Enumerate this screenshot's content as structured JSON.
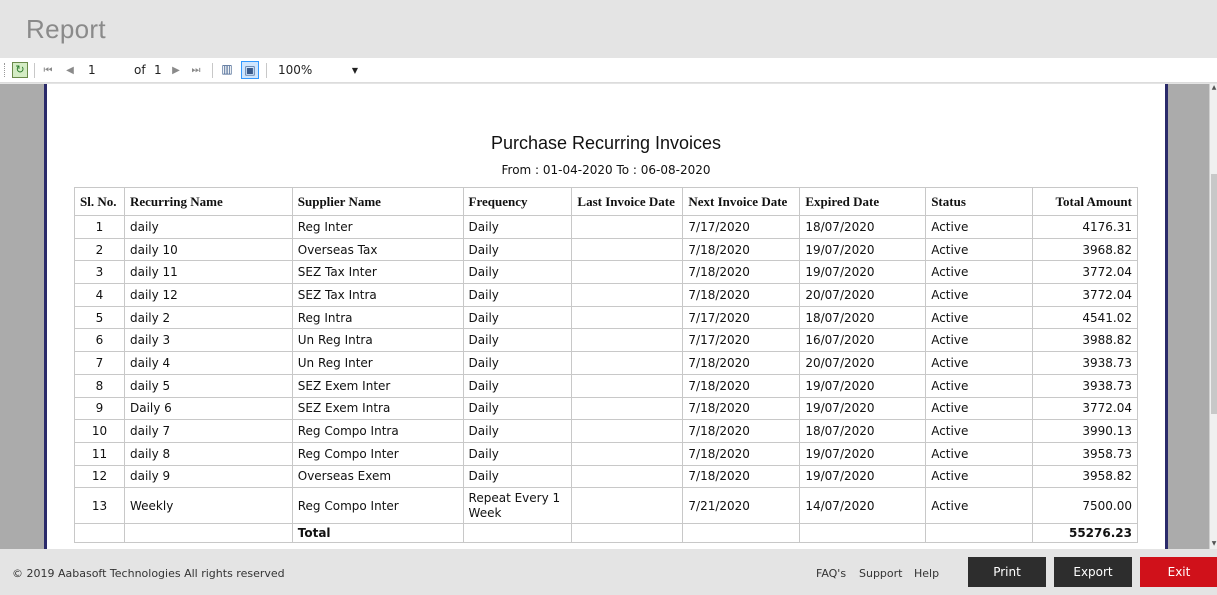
{
  "window": {
    "title": "Report"
  },
  "toolbar": {
    "page_current": "1",
    "of_label": "of",
    "page_total": "1",
    "zoom": "100%"
  },
  "report": {
    "title": "Purchase Recurring Invoices",
    "date_range": "From : 01-04-2020 To : 06-08-2020",
    "columns": [
      "Sl. No.",
      "Recurring Name",
      "Supplier Name",
      "Frequency",
      "Last Invoice Date",
      "Next Invoice Date",
      "Expired Date",
      "Status",
      "Total Amount"
    ],
    "rows": [
      [
        "1",
        "daily",
        "Reg Inter",
        "Daily",
        "",
        "7/17/2020",
        "18/07/2020",
        "Active",
        "4176.31"
      ],
      [
        "2",
        "daily 10",
        "Overseas Tax",
        "Daily",
        "",
        "7/18/2020",
        "19/07/2020",
        "Active",
        "3968.82"
      ],
      [
        "3",
        "daily 11",
        "SEZ Tax Inter",
        "Daily",
        "",
        "7/18/2020",
        "19/07/2020",
        "Active",
        "3772.04"
      ],
      [
        "4",
        "daily 12",
        "SEZ Tax Intra",
        "Daily",
        "",
        "7/18/2020",
        "20/07/2020",
        "Active",
        "3772.04"
      ],
      [
        "5",
        "daily 2",
        "Reg Intra",
        "Daily",
        "",
        "7/17/2020",
        "18/07/2020",
        "Active",
        "4541.02"
      ],
      [
        "6",
        "daily 3",
        "Un Reg Intra",
        "Daily",
        "",
        "7/17/2020",
        "16/07/2020",
        "Active",
        "3988.82"
      ],
      [
        "7",
        "daily 4",
        "Un Reg Inter",
        "Daily",
        "",
        "7/18/2020",
        "20/07/2020",
        "Active",
        "3938.73"
      ],
      [
        "8",
        "daily 5",
        "SEZ Exem Inter",
        "Daily",
        "",
        "7/18/2020",
        "19/07/2020",
        "Active",
        "3938.73"
      ],
      [
        "9",
        "Daily 6",
        "SEZ Exem Intra",
        "Daily",
        "",
        "7/18/2020",
        "19/07/2020",
        "Active",
        "3772.04"
      ],
      [
        "10",
        "daily 7",
        "Reg Compo Intra",
        "Daily",
        "",
        "7/18/2020",
        "18/07/2020",
        "Active",
        "3990.13"
      ],
      [
        "11",
        "daily 8",
        "Reg Compo Inter",
        "Daily",
        "",
        "7/18/2020",
        "19/07/2020",
        "Active",
        "3958.73"
      ],
      [
        "12",
        "daily 9",
        "Overseas Exem",
        "Daily",
        "",
        "7/18/2020",
        "19/07/2020",
        "Active",
        "3958.82"
      ],
      [
        "13",
        "Weekly",
        "Reg Compo Inter",
        "Repeat Every 1 Week",
        "",
        "7/21/2020",
        "14/07/2020",
        "Active",
        "7500.00"
      ]
    ],
    "total_label": "Total",
    "total_amount": "55276.23"
  },
  "footer": {
    "copyright": "© 2019 Aabasoft Technologies All rights reserved",
    "faq": "FAQ's",
    "support": "Support",
    "help": "Help",
    "print": "Print",
    "export": "Export",
    "exit": "Exit"
  }
}
